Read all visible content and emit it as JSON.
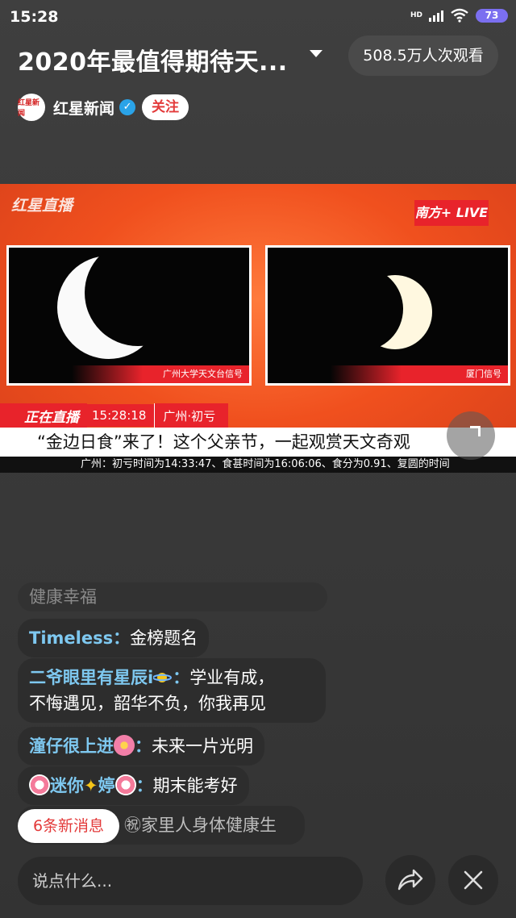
{
  "status_bar": {
    "time": "15:28",
    "network": "HD",
    "battery": "73"
  },
  "header": {
    "title": "2020年最值得期待天...",
    "viewers": "508.5万人次观看",
    "author": {
      "name": "红星新闻",
      "avatar_text": "红星新闻",
      "follow_label": "关注"
    }
  },
  "video": {
    "brand": "红星直播",
    "live_badge": "南方+ LIVE",
    "left_caption": "广州大学天文台信号",
    "right_caption": "厦门信号",
    "on_air_label": "正在直播",
    "clock": "15:28:18",
    "location": "广州·初亏",
    "headline": "“金边日食”来了！这个父亲节，一起观赏天文奇观",
    "ticker": "广州：初亏时间为14:33:47、食甚时间为16:06:06、食分为0.91、复圆的时间"
  },
  "chat": {
    "faded_top": "健康幸福",
    "messages": [
      {
        "user": "Timeless",
        "text": "金榜题名"
      },
      {
        "user": "二爷眼里有星辰i",
        "text": "学业有成，",
        "text2": "不悔遇见，韶华不负，你我再见"
      },
      {
        "user": "潼仔很上进",
        "text": "未来一片光明"
      },
      {
        "user": "迷你",
        "user2": "婷",
        "text": "期末能考好"
      }
    ],
    "partial": "㊗家里人身体健康生",
    "new_messages": "6条新消息",
    "input_placeholder": "说点什么..."
  },
  "colors": {
    "accent_red": "#e8232b",
    "username_blue": "#7ec8f0",
    "follow_red": "#e33a3a"
  }
}
